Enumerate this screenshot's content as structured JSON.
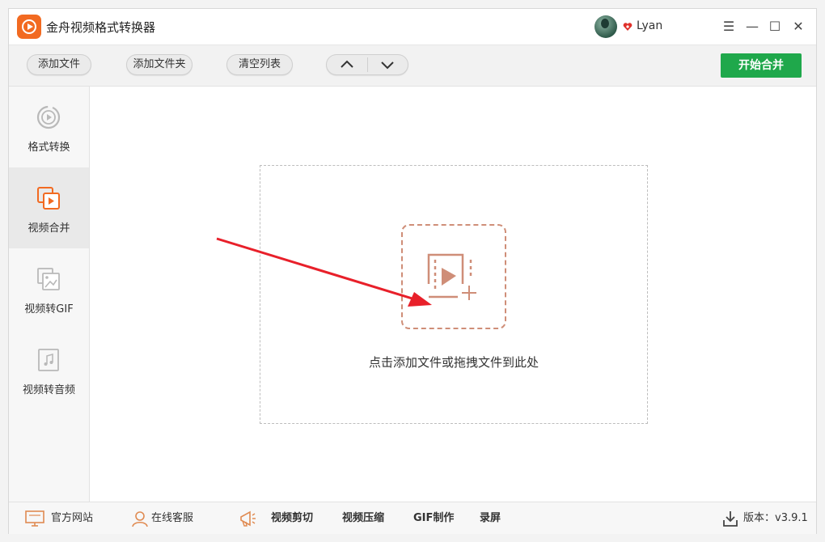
{
  "app": {
    "title": "金舟视频格式转换器",
    "username": "Lyan"
  },
  "window_controls": {
    "menu": "☰",
    "minimize": "—",
    "maximize": "☐",
    "close": "✕"
  },
  "toolbar": {
    "add_file": "添加文件",
    "add_folder": "添加文件夹",
    "clear_list": "清空列表",
    "start": "开始合并"
  },
  "sidebar": {
    "items": [
      {
        "label": "格式转换",
        "icon": "format-convert-icon"
      },
      {
        "label": "视频合并",
        "icon": "video-merge-icon",
        "active": true
      },
      {
        "label": "视频转GIF",
        "icon": "video-to-gif-icon"
      },
      {
        "label": "视频转音频",
        "icon": "video-to-audio-icon"
      }
    ]
  },
  "main": {
    "drop_hint": "点击添加文件或拖拽文件到此处"
  },
  "footer": {
    "website": "官方网站",
    "support": "在线客服",
    "tools": [
      "视频剪切",
      "视频压缩",
      "GIF制作",
      "录屏"
    ],
    "version": "版本：v3.9.1"
  },
  "colors": {
    "accent": "#f26a21",
    "start_button": "#1fa84b",
    "drop_icon": "#cf8e78",
    "arrow": "#e8202a"
  }
}
